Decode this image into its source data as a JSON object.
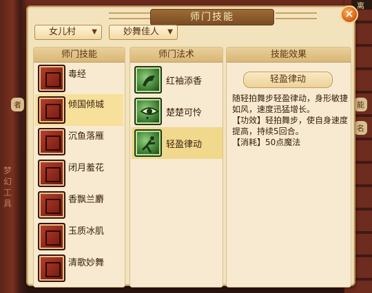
{
  "window": {
    "title": "师门技能",
    "close_symbol": "✕"
  },
  "filters": {
    "sect": "女儿村",
    "school": "妙舞佳人"
  },
  "columns": {
    "skills_header": "师门技能",
    "spells_header": "师门法术",
    "effect_header": "技能效果"
  },
  "skills": [
    {
      "label": "毒经",
      "icon": "poison-scripture-icon"
    },
    {
      "label": "倾国倾城",
      "icon": "beauty-icon"
    },
    {
      "label": "沉鱼落雁",
      "icon": "fish-goose-icon"
    },
    {
      "label": "闭月羞花",
      "icon": "moon-flower-icon"
    },
    {
      "label": "香飘兰麝",
      "icon": "fragrance-icon"
    },
    {
      "label": "玉质冰肌",
      "icon": "jade-skin-icon"
    },
    {
      "label": "清歌妙舞",
      "icon": "song-dance-icon"
    }
  ],
  "selected_skill_index": 1,
  "spells": [
    {
      "label": "红袖添香",
      "icon": "red-sleeve-icon"
    },
    {
      "label": "楚楚可怜",
      "icon": "tearful-eye-icon"
    },
    {
      "label": "轻盈律动",
      "icon": "dancing-figure-icon"
    }
  ],
  "selected_spell_index": 2,
  "effect": {
    "name": "轻盈律动",
    "description": "随轻拍舞步轻盈律动，身形敏捷如风，速度迅猛增长。",
    "effect_line": "【功效】轻拍舞步，使自身速度提高，持续5回合。",
    "cost_line": "【消耗】50点魔法"
  },
  "background": {
    "left_vertical_text": "梦幻工具",
    "top_right_text": "离",
    "pill_left": "者",
    "pill_right": "能",
    "pill_right_2": "名"
  },
  "colors": {
    "panel_bg": "#f3e3bd",
    "selected_row": "#f6e09a",
    "title_bar": "#8a5a2a",
    "close_button": "#d8661c"
  }
}
